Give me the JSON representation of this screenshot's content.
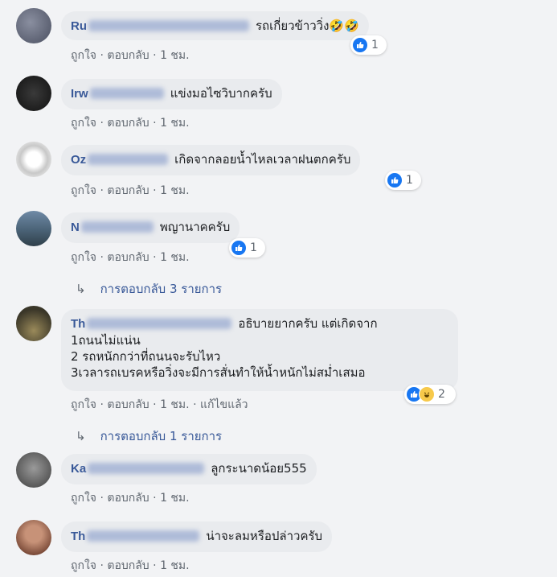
{
  "colors": {
    "background": "#f2f3f5",
    "bubble": "#e9ebee",
    "name": "#385898",
    "like": "#1877f2",
    "meta": "#606770"
  },
  "actions": {
    "like": "ถูกใจ",
    "reply": "ตอบกลับ",
    "sep": "·"
  },
  "comments": [
    {
      "name": "Ru",
      "text": "รถเกี่ยวข้าววิ่ง🤣🤣",
      "time": "1 ชม.",
      "reactions": {
        "icons": [
          "like-icon"
        ],
        "count": "1"
      }
    },
    {
      "name": "Irw",
      "text": "แข่งมอไซวิบากครับ",
      "time": "1 ชม."
    },
    {
      "name": "Oz",
      "text": "เกิดจากลอยน้ำไหลเวลาฝนตกครับ",
      "time": "1 ชม.",
      "reactions": {
        "icons": [
          "like-icon"
        ],
        "count": "1"
      }
    },
    {
      "name": "N",
      "text": "พญานาคครับ",
      "time": "1 ชม.",
      "reactions": {
        "icons": [
          "like-icon"
        ],
        "count": "1"
      },
      "replies": "การตอบกลับ 3 รายการ"
    },
    {
      "name": "Th",
      "text_lines": [
        "อธิบายยากครับ แต่เกิดจาก",
        "1ถนนไม่แน่น",
        "2 รถหนักกว่าที่ถนนจะรับไหว",
        "3เวลารถเบรคหรือวิ่งจะมีการสั่นทำให้น้ำหนักไม่สม่ำเสมอ"
      ],
      "time": "1 ชม.",
      "edited": "แก้ไขแล้ว",
      "reactions": {
        "icons": [
          "like-icon",
          "haha-icon"
        ],
        "count": "2"
      },
      "replies": "การตอบกลับ 1 รายการ"
    },
    {
      "name": "Ka",
      "text": "ลูกระนาดน้อย555",
      "time": "1 ชม."
    },
    {
      "name": "Th",
      "text": "น่าจะลมหรือปล่าวครับ",
      "time": "1 ชม."
    }
  ]
}
